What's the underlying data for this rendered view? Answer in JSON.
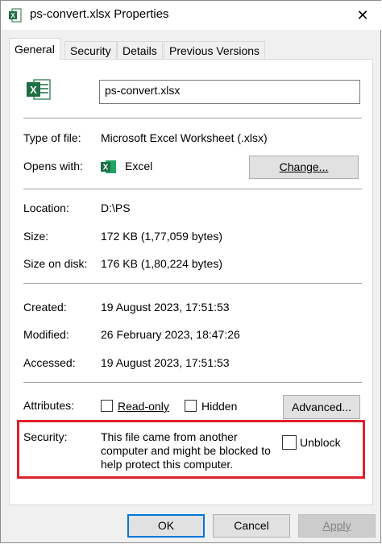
{
  "window": {
    "title": "ps-convert.xlsx Properties",
    "close_glyph": "✕"
  },
  "tabs": [
    {
      "label": "General",
      "active": true
    },
    {
      "label": "Security",
      "active": false
    },
    {
      "label": "Details",
      "active": false
    },
    {
      "label": "Previous Versions",
      "active": false
    }
  ],
  "file": {
    "icon": "excel-file-icon",
    "name": "ps-convert.xlsx"
  },
  "info": {
    "type_label": "Type of file:",
    "type_value": "Microsoft Excel Worksheet (.xlsx)",
    "opens_label": "Opens with:",
    "opens_value": "Excel",
    "change_button": "Change...",
    "location_label": "Location:",
    "location_value": "D:\\PS",
    "size_label": "Size:",
    "size_value": "172 KB (1,77,059 bytes)",
    "size_disk_label": "Size on disk:",
    "size_disk_value": "176 KB (1,80,224 bytes)",
    "created_label": "Created:",
    "created_value": "19 August 2023, 17:51:53",
    "modified_label": "Modified:",
    "modified_value": "26 February 2023, 18:47:26",
    "accessed_label": "Accessed:",
    "accessed_value": "19 August 2023, 17:51:53"
  },
  "attributes": {
    "label": "Attributes:",
    "readonly_label": "Read-only",
    "readonly_checked": false,
    "hidden_label": "Hidden",
    "hidden_checked": false,
    "advanced_button": "Advanced..."
  },
  "security": {
    "label": "Security:",
    "message_line1": "This file came from another",
    "message_line2": "computer and might be blocked to",
    "message_line3": "help protect this computer.",
    "unblock_label": "Unblock",
    "unblock_checked": false,
    "highlight_color": "#e0202a"
  },
  "footer": {
    "ok": "OK",
    "cancel": "Cancel",
    "apply": "Apply"
  },
  "colors": {
    "excel_green": "#1d6f42",
    "accent": "#0078d7"
  }
}
